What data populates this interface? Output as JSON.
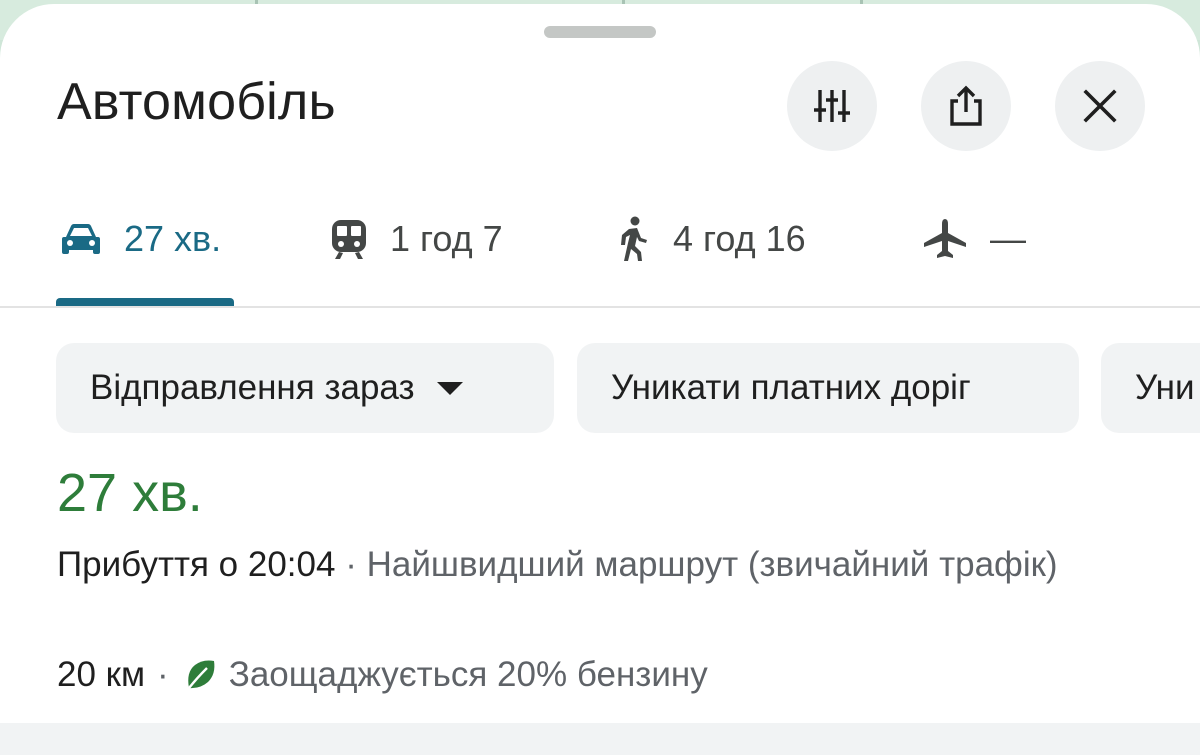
{
  "header": {
    "title": "Автомобіль",
    "buttons": {
      "options_icon": "tune-icon",
      "share_icon": "share-icon",
      "close_icon": "close-icon"
    }
  },
  "tabs": [
    {
      "icon": "car-icon",
      "label": "27 хв.",
      "active": true
    },
    {
      "icon": "train-icon",
      "label": "1 год 7",
      "active": false
    },
    {
      "icon": "walk-icon",
      "label": "4 год 16",
      "active": false
    },
    {
      "icon": "airplane-icon",
      "label": "—",
      "active": false
    }
  ],
  "chips": [
    {
      "label": "Відправлення зараз",
      "has_dropdown": true
    },
    {
      "label": "Уникати платних доріг",
      "has_dropdown": false
    },
    {
      "label": "Уни",
      "has_dropdown": false
    }
  ],
  "route": {
    "duration": "27 хв.",
    "arrival": "Прибуття о 20:04",
    "separator": "·",
    "description": "Найшвидший маршрут (звичайний трафік)",
    "distance": "20 км",
    "eco_text": "Заощаджується 20% бензину",
    "eco_icon": "leaf-icon"
  },
  "colors": {
    "accent": "#1a6a85",
    "duration_green": "#2e7d3a",
    "eco_green": "#2e7d3a",
    "chip_bg": "#f1f3f4"
  }
}
